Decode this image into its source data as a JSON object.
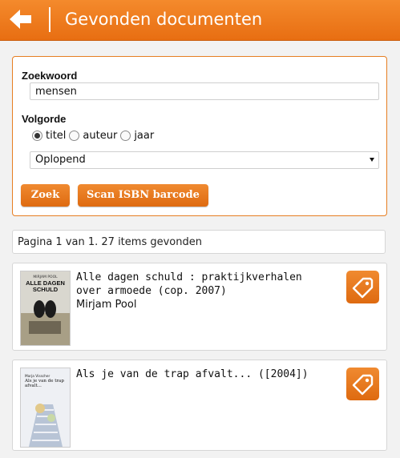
{
  "header": {
    "title": "Gevonden documenten"
  },
  "search": {
    "keyword_label": "Zoekwoord",
    "keyword_value": "mensen",
    "sort_label": "Volgorde",
    "sort_options": [
      "titel",
      "auteur",
      "jaar"
    ],
    "sort_selected": "titel",
    "order_value": "Oplopend",
    "search_button": "Zoek",
    "scan_button": "Scan ISBN barcode"
  },
  "status": {
    "text": "Pagina 1 van 1. 27 items gevonden"
  },
  "results": [
    {
      "title": "Alle dagen schuld : praktijkverhalen over armoede (cop. 2007)",
      "author": "Mirjam Pool",
      "cover_author": "MIRJAM POOL",
      "cover_title": "ALLE DAGEN SCHULD"
    },
    {
      "title": "Als je van de trap afvalt... ([2004])",
      "author": "",
      "cover_author": "Marja Visscher",
      "cover_title": "Als je van de trap afvalt..."
    }
  ],
  "colors": {
    "accent": "#e87a1c",
    "header": "#ee7d22"
  }
}
